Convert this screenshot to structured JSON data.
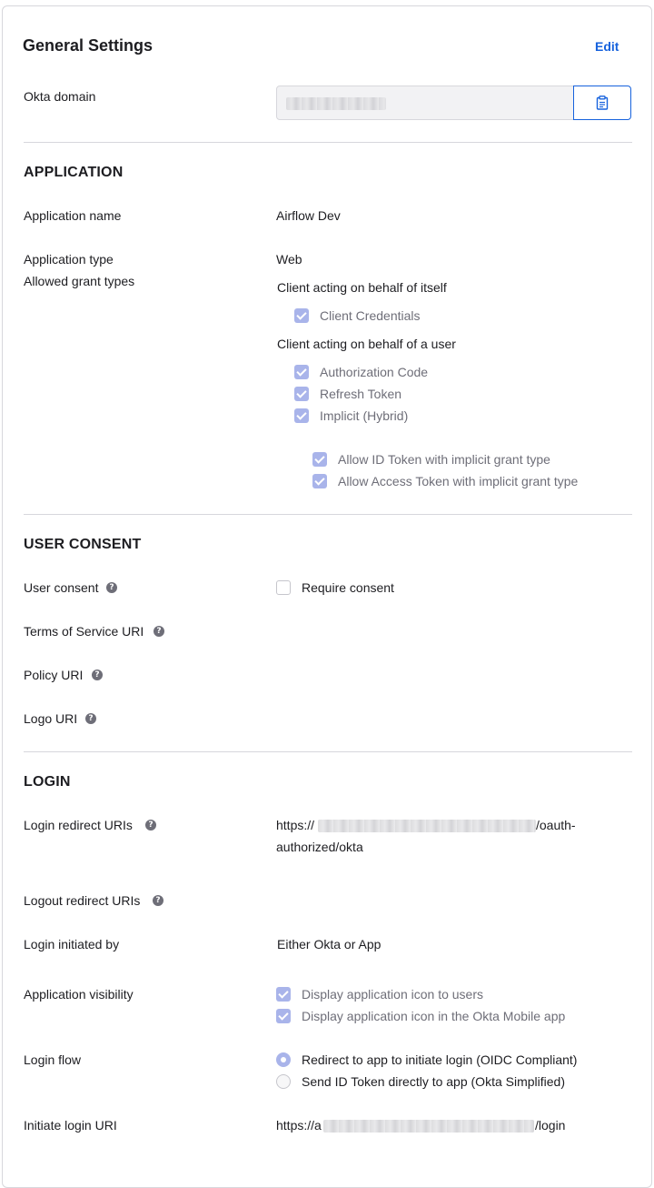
{
  "header": {
    "title": "General Settings",
    "edit_label": "Edit"
  },
  "okta_domain": {
    "label": "Okta domain",
    "copy_icon": "clipboard-icon"
  },
  "application": {
    "heading": "APPLICATION",
    "name_label": "Application name",
    "name_value": "Airflow Dev",
    "type_label": "Application type",
    "type_value": "Web",
    "grant_types_label": "Allowed grant types",
    "self_group_label": "Client acting on behalf of itself",
    "client_credentials": "Client Credentials",
    "user_group_label": "Client acting on behalf of a user",
    "authorization_code": "Authorization Code",
    "refresh_token": "Refresh Token",
    "implicit_hybrid": "Implicit (Hybrid)",
    "allow_id_token": "Allow ID Token with implicit grant type",
    "allow_access_token": "Allow Access Token with implicit grant type"
  },
  "user_consent": {
    "heading": "USER CONSENT",
    "consent_label": "User consent",
    "require_consent": "Require consent",
    "tos_label": "Terms of Service URI",
    "policy_label": "Policy URI",
    "logo_label": "Logo URI"
  },
  "login": {
    "heading": "LOGIN",
    "redirect_label": "Login redirect URIs",
    "redirect_prefix": "https://",
    "redirect_suffix": "/oauth-",
    "redirect_line2": "authorized/okta",
    "logout_label": "Logout redirect URIs",
    "initiated_label": "Login initiated by",
    "initiated_value": "Either Okta or App",
    "visibility_label": "Application visibility",
    "display_icon_users": "Display application icon to users",
    "display_icon_mobile": "Display application icon in the Okta Mobile app",
    "flow_label": "Login flow",
    "flow_redirect": "Redirect to app to initiate login (OIDC Compliant)",
    "flow_send_id": "Send ID Token directly to app (Okta Simplified)",
    "initiate_uri_label": "Initiate login URI",
    "initiate_uri_prefix": "https://a",
    "initiate_uri_suffix": "/login"
  },
  "help_icon_glyph": "?",
  "colors": {
    "accent": "#1662dd",
    "checkbox_checked": "#a9b4ea",
    "divider": "#d7d7dc",
    "muted_text": "#6e6e78"
  }
}
